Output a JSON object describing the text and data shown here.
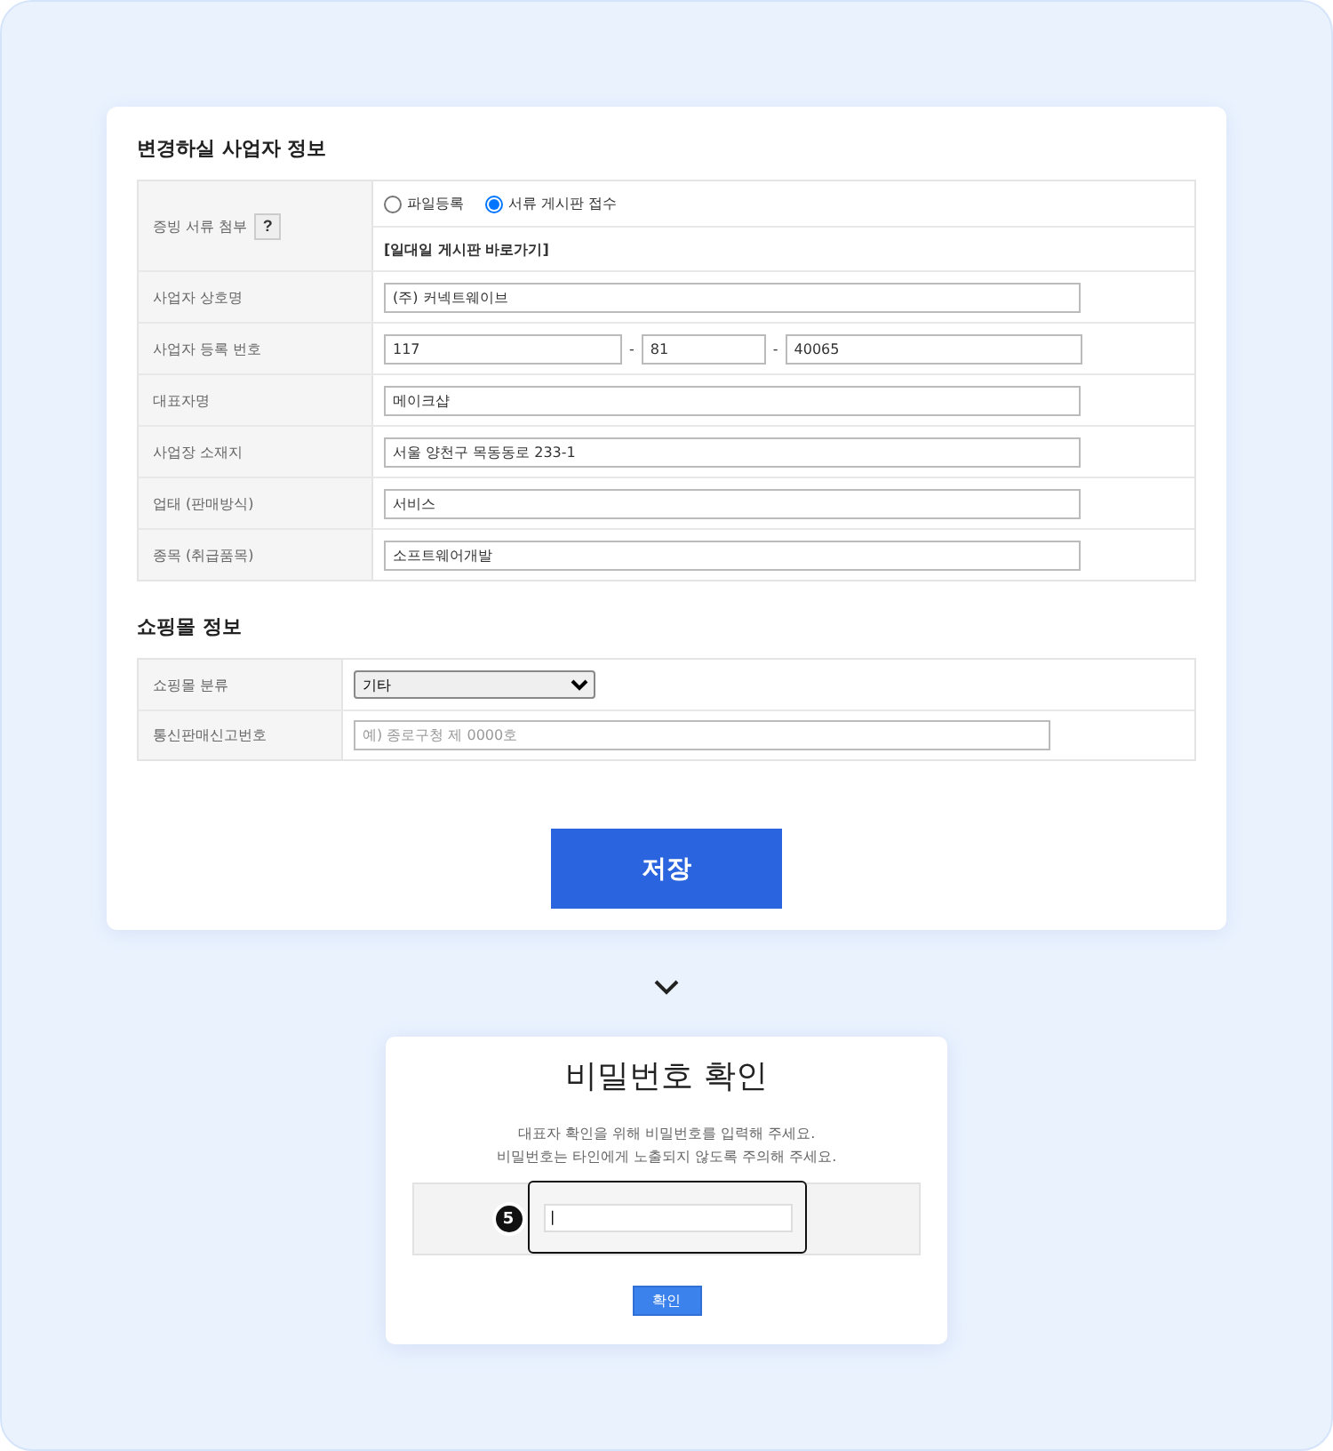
{
  "business_section": {
    "title": "변경하실 사업자 정보",
    "attachment": {
      "label": "증빙 서류 첨부",
      "help": "?",
      "options": [
        {
          "label": "파일등록",
          "selected": false
        },
        {
          "label": "서류 게시판 접수",
          "selected": true
        }
      ],
      "link": "[일대일 게시판 바로가기]"
    },
    "rows": [
      {
        "kind": "text",
        "label": "사업자 상호명",
        "value": "(주) 커넥트웨이브"
      },
      {
        "kind": "bizno",
        "label": "사업자 등록 번호",
        "parts": [
          "117",
          "81",
          "40065"
        ],
        "separator": "-"
      },
      {
        "kind": "text",
        "label": "대표자명",
        "value": "메이크샵"
      },
      {
        "kind": "text",
        "label": "사업장 소재지",
        "value": "서울 양천구 목동동로 233-1"
      },
      {
        "kind": "text",
        "label": "업태 (판매방식)",
        "value": "서비스"
      },
      {
        "kind": "text",
        "label": "종목 (취급품목)",
        "value": "소프트웨어개발"
      }
    ]
  },
  "shop_section": {
    "title": "쇼핑몰 정보",
    "rows": [
      {
        "kind": "select",
        "label": "쇼핑몰 분류",
        "value": "기타"
      },
      {
        "kind": "input",
        "label": "통신판매신고번호",
        "placeholder": "예) 종로구청 제 0000호"
      }
    ]
  },
  "save_button": "저장",
  "dialog": {
    "title": "비밀번호 확인",
    "lines": [
      "대표자 확인을 위해 비밀번호를 입력해 주세요.",
      "비밀번호는 타인에게 노출되지 않도록 주의해 주세요."
    ],
    "step": "5",
    "password": "|",
    "confirm": "확인"
  }
}
